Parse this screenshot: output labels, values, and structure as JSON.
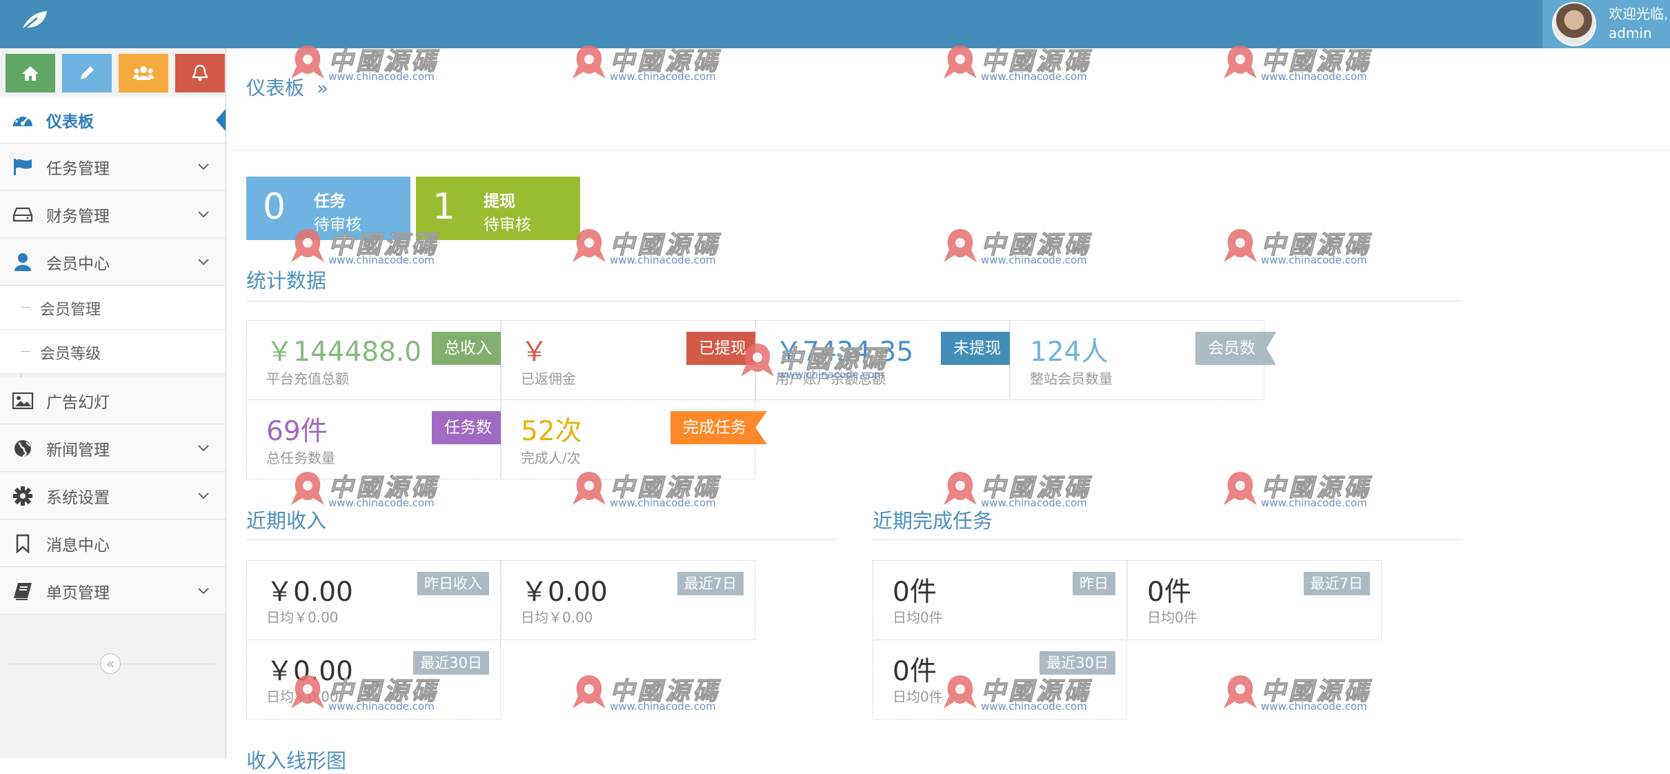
{
  "header": {
    "welcome": "欢迎光临,",
    "username": "admin"
  },
  "shortcuts": [
    {
      "icon": "home-icon",
      "color": "#62a764"
    },
    {
      "icon": "pencil-icon",
      "color": "#6fb3e0"
    },
    {
      "icon": "users-icon",
      "color": "#f6aa3d"
    },
    {
      "icon": "bell-icon",
      "color": "#d15b47"
    }
  ],
  "sidebar": {
    "items": [
      {
        "label": "仪表板",
        "icon": "dashboard-icon",
        "active": true
      },
      {
        "label": "任务管理",
        "icon": "flag-icon"
      },
      {
        "label": "财务管理",
        "icon": "hdd-icon"
      },
      {
        "label": "会员中心",
        "icon": "user-icon"
      },
      {
        "label": "广告幻灯",
        "icon": "picture-icon"
      },
      {
        "label": "新闻管理",
        "icon": "globe-icon"
      },
      {
        "label": "系统设置",
        "icon": "cog-icon"
      },
      {
        "label": "消息中心",
        "icon": "bookmark-icon"
      },
      {
        "label": "单页管理",
        "icon": "book-icon"
      }
    ],
    "subitems": [
      {
        "label": "会员管理"
      },
      {
        "label": "会员等级"
      }
    ],
    "collapse_symbol": "«"
  },
  "breadcrumb": {
    "title": "仪表板",
    "sep": "»"
  },
  "infoboxes": [
    {
      "num": "0",
      "t1": "任务",
      "t2": "待审核",
      "color": "#6fb3e0"
    },
    {
      "num": "1",
      "t1": "提现",
      "t2": "待审核",
      "color": "#9abc32"
    }
  ],
  "stats": {
    "title": "统计数据",
    "cards": [
      {
        "value": "￥144488.0",
        "desc": "平台充值总额",
        "tag": "总收入",
        "value_color": "#87b87f",
        "tag_color": "#82af6f"
      },
      {
        "value": "￥",
        "desc": "已返佣金",
        "tag": "已提现",
        "value_color": "#d15b47",
        "tag_color": "#d15b47"
      },
      {
        "value": "￥7434.35",
        "desc": "用户账户余额总额",
        "tag": "未提现",
        "value_color": "#478fca",
        "tag_color": "#438eb9"
      },
      {
        "value": "124人",
        "desc": "整站会员数量",
        "tag": "会员数",
        "value_color": "#6fb3e0",
        "tag_color": "#abbac3"
      },
      {
        "value": "69件",
        "desc": "总任务数量",
        "tag": "任务数",
        "value_color": "#a069c3",
        "tag_color": "#a069c3"
      },
      {
        "value": "52次",
        "desc": "完成人/次",
        "tag": "完成任务",
        "value_color": "#e8b110",
        "tag_color": "#ff892a"
      }
    ]
  },
  "income": {
    "title": "近期收入",
    "cards": [
      {
        "value": "￥0.00",
        "desc": "日均￥0.00",
        "tag": "昨日收入"
      },
      {
        "value": "￥0.00",
        "desc": "日均￥0.00",
        "tag": "最近7日"
      },
      {
        "value": "￥0.00",
        "desc": "日均￥0.00",
        "tag": "最近30日"
      }
    ]
  },
  "tasks": {
    "title": "近期完成任务",
    "cards": [
      {
        "value": "0件",
        "desc": "日均0件",
        "tag": "昨日"
      },
      {
        "value": "0件",
        "desc": "日均0件",
        "tag": "最近7日"
      },
      {
        "value": "0件",
        "desc": "日均0件",
        "tag": "最近30日"
      }
    ]
  },
  "chart_section": {
    "title": "收入线形图"
  },
  "watermark": {
    "text": "中國源碼",
    "url": "www.chinacode.com"
  }
}
